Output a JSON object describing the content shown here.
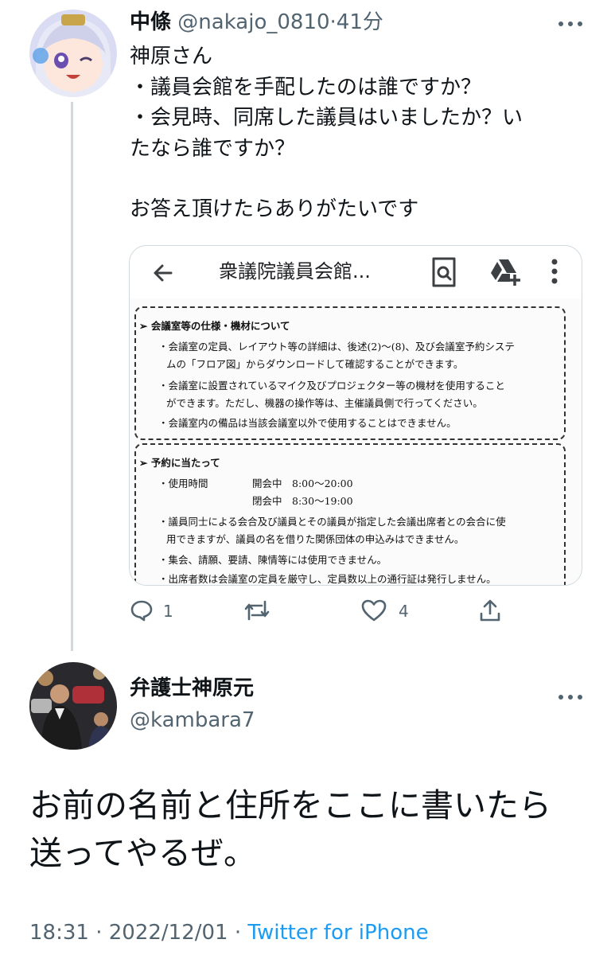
{
  "reply": {
    "name": "中條",
    "handle": "@nakajo_0810",
    "separator": "·",
    "time": "41分",
    "lines": [
      "神原さん",
      "・議員会館を手配したのは誰ですか？",
      "・会見時、同席した議員はいましたか？い",
      "たなら誰ですか？",
      "",
      "お答え頂けたらありがたいです"
    ],
    "card": {
      "title": "衆議院議員会館...",
      "doc_lines": [
        "➢ 会議室等の仕様・機材について",
        "・会議室の定員、レイアウト等の詳細は、後述(2)〜(8)、及び会議室予約システ",
        "ムの「フロア図」からダウンロードして確認することができます。",
        "・会議室に設置されているマイク及びプロジェクター等の機材を使用すること",
        "ができます。ただし、機器の操作等は、主催議員側で行ってください。",
        "・会議室内の備品は当該会議室以外で使用することはできません。",
        "➢ 予約に当たって",
        "・使用時間",
        "開会中　8:00〜20:00",
        "閉会中　8:30〜19:00",
        "・議員同士による会合及び議員とその議員が指定した会議出席者との会合に使",
        "用できますが、議員の名を借りた関係団体の申込みはできません。",
        "・集会、請願、要請、陳情等には使用できません。",
        "・出席者数は会議室の定員を厳守し、定員数以上の通行証は発行しません。"
      ]
    },
    "reply_count": "1",
    "like_count": "4"
  },
  "main": {
    "name": "弁護士神原元",
    "handle": "@kambara7",
    "lines": [
      "お前の名前と住所をここに書いたら",
      "送ってやるぜ。"
    ],
    "time": "18:31",
    "sep1": "·",
    "date": "2022/12/01",
    "sep2": "·",
    "app": "Twitter for iPhone"
  },
  "icons": {
    "more": "more-horizontal-icon",
    "reply": "reply-icon",
    "retweet": "retweet-icon",
    "like": "like-icon",
    "share": "share-icon",
    "back": "back-arrow-icon",
    "doc_search": "document-search-icon",
    "drive_add": "add-to-drive-icon",
    "kebab": "more-vertical-icon"
  },
  "colors": {
    "text": "#0f1419",
    "secondary": "#536471",
    "link": "#1d9bf0",
    "border": "#cfd9de"
  }
}
